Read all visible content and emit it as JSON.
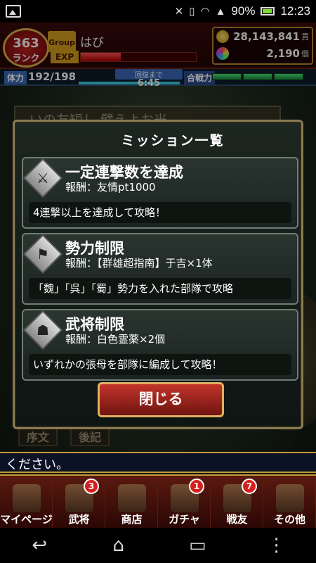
{
  "status_bar": {
    "battery_percent": "90%",
    "time": "12:23"
  },
  "hud": {
    "rank_number": "363",
    "rank_label": "ランク",
    "group_tag": "Group",
    "player_name": "はび",
    "exp_label": "EXP",
    "exp_progress": 0.35,
    "currency": {
      "value": "28,143,841",
      "unit": "貫"
    },
    "gems": {
      "value": "2,190",
      "unit": "個"
    },
    "stamina_label": "体力",
    "stamina_value": "192/198",
    "stamina_progress": 0.97,
    "recovery_label": "回復まで",
    "recovery_time": "6:45",
    "power_label": "合戦力"
  },
  "background": {
    "banner_text": "いの友短し 譬えよお米",
    "tab_left": "序文",
    "tab_right": "後記"
  },
  "modal": {
    "title": "ミッション一覧",
    "missions": [
      {
        "title": "一定連撃数を達成",
        "reward": "報酬：友情pt1000",
        "description": "4連撃以上を達成して攻略！"
      },
      {
        "title": "勢力制限",
        "reward": "報酬：【群雄超指南】于吉×1体",
        "description": "「魏」「呉」「蜀」勢力を入れた部隊で攻略"
      },
      {
        "title": "武将制限",
        "reward": "報酬：白色霊薬×2個",
        "description": "いずれかの張母を部隊に編成して攻略！"
      }
    ],
    "close_label": "閉じる"
  },
  "message_bar": "ください。",
  "bottom_nav": [
    {
      "label": "マイページ",
      "badge": ""
    },
    {
      "label": "武将",
      "badge": "3"
    },
    {
      "label": "商店",
      "badge": ""
    },
    {
      "label": "ガチャ",
      "badge": "1"
    },
    {
      "label": "戦友",
      "badge": "7"
    },
    {
      "label": "その他",
      "badge": ""
    }
  ]
}
